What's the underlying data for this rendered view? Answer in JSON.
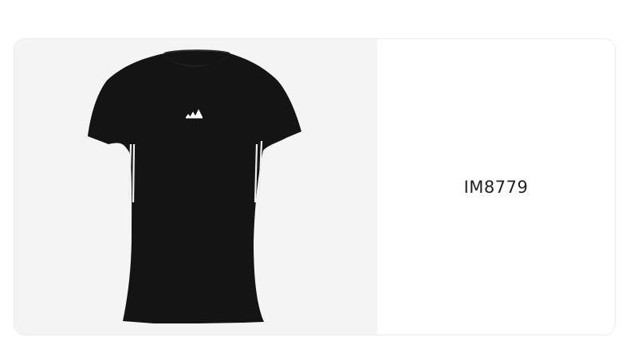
{
  "product_card": {
    "image": {
      "icon": "tshirt-black-with-logo",
      "shirt_color": "#141414",
      "background_color": "#f4f4f4",
      "stripe_color": "#f0f0f0"
    },
    "sku": "IM8779"
  }
}
